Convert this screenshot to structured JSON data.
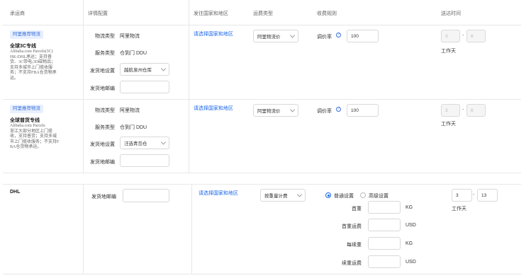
{
  "headers": {
    "carrier": "承运商",
    "detail": "详情配置",
    "destination": "发往国家和地区",
    "fee_type": "运费类型",
    "fee_rule": "收费规则",
    "delivery_time": "送达时间"
  },
  "rows": [
    {
      "badge": "阿里推荐物流",
      "name": "全球3C专线",
      "desc": [
        "Alibaba.com Parcels(3C)",
        "HK-DHL承运；支持普",
        "货、3C带电;3D磁物品；",
        "支持多城市上门揽收服",
        "务；不支持FBA仓货物承",
        "运。"
      ],
      "logistics_type_label": "物流类型",
      "logistics_type_value": "阿里物流",
      "service_type_label": "服务类型",
      "service_type_value": "仓到门 DDU",
      "ship_from_label": "发货地设置",
      "ship_from_value": "越航泉州仓库",
      "postcode_label": "发货地邮编",
      "postcode_value": "",
      "destination_link": "请选择国家和地区",
      "fee_type_value": "阿里物流价",
      "rate_label": "调价率",
      "rate_help": "?",
      "rate_value": "100",
      "days_from": "3",
      "days_to": "6",
      "days_unit": "工作天"
    },
    {
      "badge": "阿里推荐物流",
      "name": "全球普货专线",
      "desc": [
        "Alibaba.com Parcels",
        "浙江大部分地区上门揽",
        "收，支持普货；支持多城",
        "市上门揽收服务；不支持F",
        "BA仓货物承运。"
      ],
      "logistics_type_label": "物流类型",
      "logistics_type_value": "阿里物流",
      "service_type_label": "服务类型",
      "service_type_value": "仓到门 DDU",
      "ship_from_label": "发货地设置",
      "ship_from_value": "汪选青岛仓",
      "postcode_label": "发货地邮编",
      "postcode_value": "",
      "destination_link": "请选择国家和地区",
      "fee_type_value": "阿里物流价",
      "rate_label": "调价率",
      "rate_help": "?",
      "rate_value": "100",
      "days_from": "3",
      "days_to": "6",
      "days_unit": "工作天"
    }
  ],
  "dhl": {
    "name": "DHL",
    "postcode_label": "发货地邮编",
    "postcode_value": "",
    "destination_link": "请选择国家和地区",
    "fee_type_value": "按重量计费",
    "radio_normal": "普通设置",
    "radio_advanced": "高级设置",
    "first_weight_label": "首重",
    "first_weight_unit": "KG",
    "first_fee_label": "首重运费",
    "first_fee_unit": "USD",
    "add_weight_label": "每续重",
    "add_weight_unit": "KG",
    "add_fee_label": "续重运费",
    "add_fee_unit": "USD",
    "days_from": "3",
    "days_to": "13",
    "days_unit": "工作天"
  },
  "colors": {
    "accent": "#1a66e8",
    "badge_bg": "#e8f0ff",
    "border": "#e8e8e8"
  }
}
